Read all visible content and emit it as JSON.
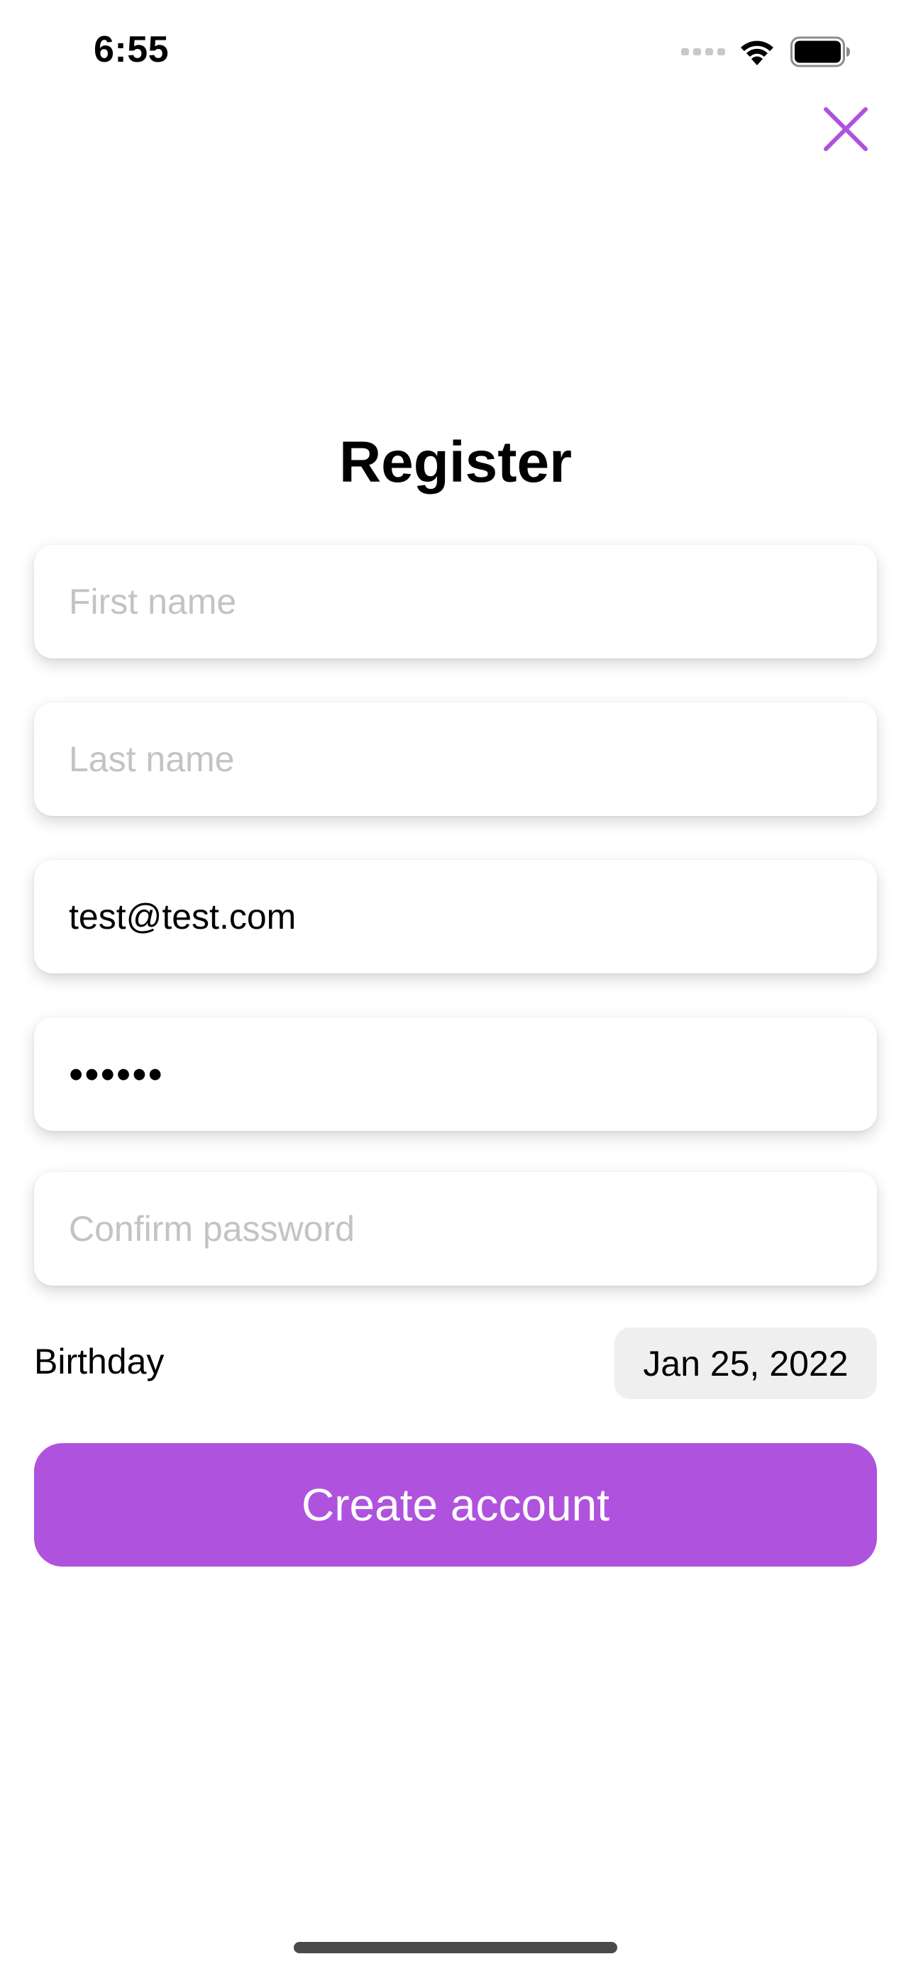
{
  "status_bar": {
    "time": "6:55",
    "icons": [
      "signal-icon",
      "wifi-icon",
      "battery-icon"
    ]
  },
  "close": {
    "icon": "close-icon",
    "color": "#af52de"
  },
  "title": "Register",
  "form": {
    "first_name": {
      "placeholder": "First name",
      "value": ""
    },
    "last_name": {
      "placeholder": "Last name",
      "value": ""
    },
    "email": {
      "placeholder": "",
      "value": "test@test.com"
    },
    "password": {
      "placeholder": "",
      "value": "••••••"
    },
    "confirm_password": {
      "placeholder": "Confirm password",
      "value": ""
    }
  },
  "birthday": {
    "label": "Birthday",
    "value": "Jan 25, 2022"
  },
  "create_button": {
    "label": "Create account",
    "color": "#af52de"
  }
}
